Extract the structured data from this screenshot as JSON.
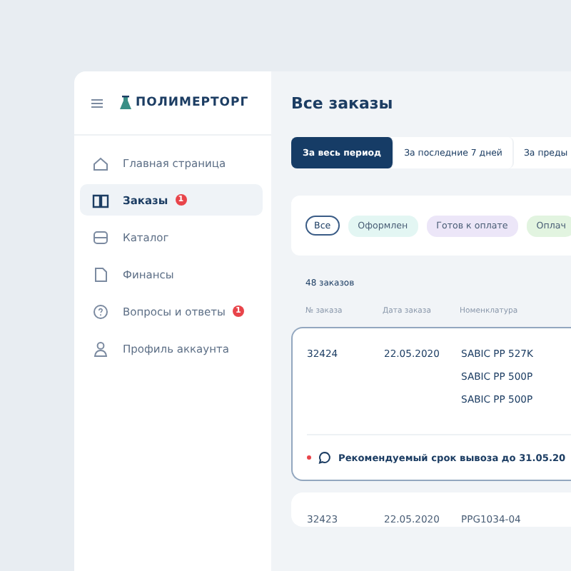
{
  "logo": {
    "text": "ПОЛИМЕРТОРГ"
  },
  "sidebar": {
    "items": [
      {
        "label": "Главная страница",
        "kind": "home",
        "selected": false
      },
      {
        "label": "Заказы",
        "kind": "book",
        "selected": true,
        "badge": "1"
      },
      {
        "label": "Каталог",
        "kind": "box",
        "selected": false
      },
      {
        "label": "Финансы",
        "kind": "doc",
        "selected": false
      },
      {
        "label": "Вопросы и ответы",
        "kind": "help",
        "selected": false,
        "badge": "1"
      },
      {
        "label": "Профиль аккаунта",
        "kind": "user",
        "selected": false
      }
    ]
  },
  "title": "Все заказы",
  "tabs": [
    {
      "label": "За весь период",
      "selected": true
    },
    {
      "label": "За последние 7 дней",
      "selected": false
    },
    {
      "label": "За преды",
      "selected": false
    }
  ],
  "filters": [
    {
      "label": "Все",
      "selected": true,
      "color": "#ffffff"
    },
    {
      "label": "Оформлен",
      "selected": false,
      "color": "#e3f6f3"
    },
    {
      "label": "Готов к оплате",
      "selected": false,
      "color": "#ece6f8"
    },
    {
      "label": "Оплач",
      "selected": false,
      "color": "#e2f4e0"
    }
  ],
  "count": "48 заказов",
  "table": {
    "columns": [
      "№ заказа",
      "Дата заказа",
      "Номенклатура"
    ],
    "rows": [
      {
        "number": "32424",
        "date": "22.05.2020",
        "items": [
          "SABIC PP 527K",
          "SABIC PP 500P",
          "SABIC PP 500P"
        ],
        "expanded": true,
        "note": "Рекомендуемый срок вывоза до 31.05.20"
      },
      {
        "number": "32423",
        "date": "22.05.2020",
        "items": [
          "PPG1034-04"
        ],
        "expanded": false
      }
    ]
  }
}
